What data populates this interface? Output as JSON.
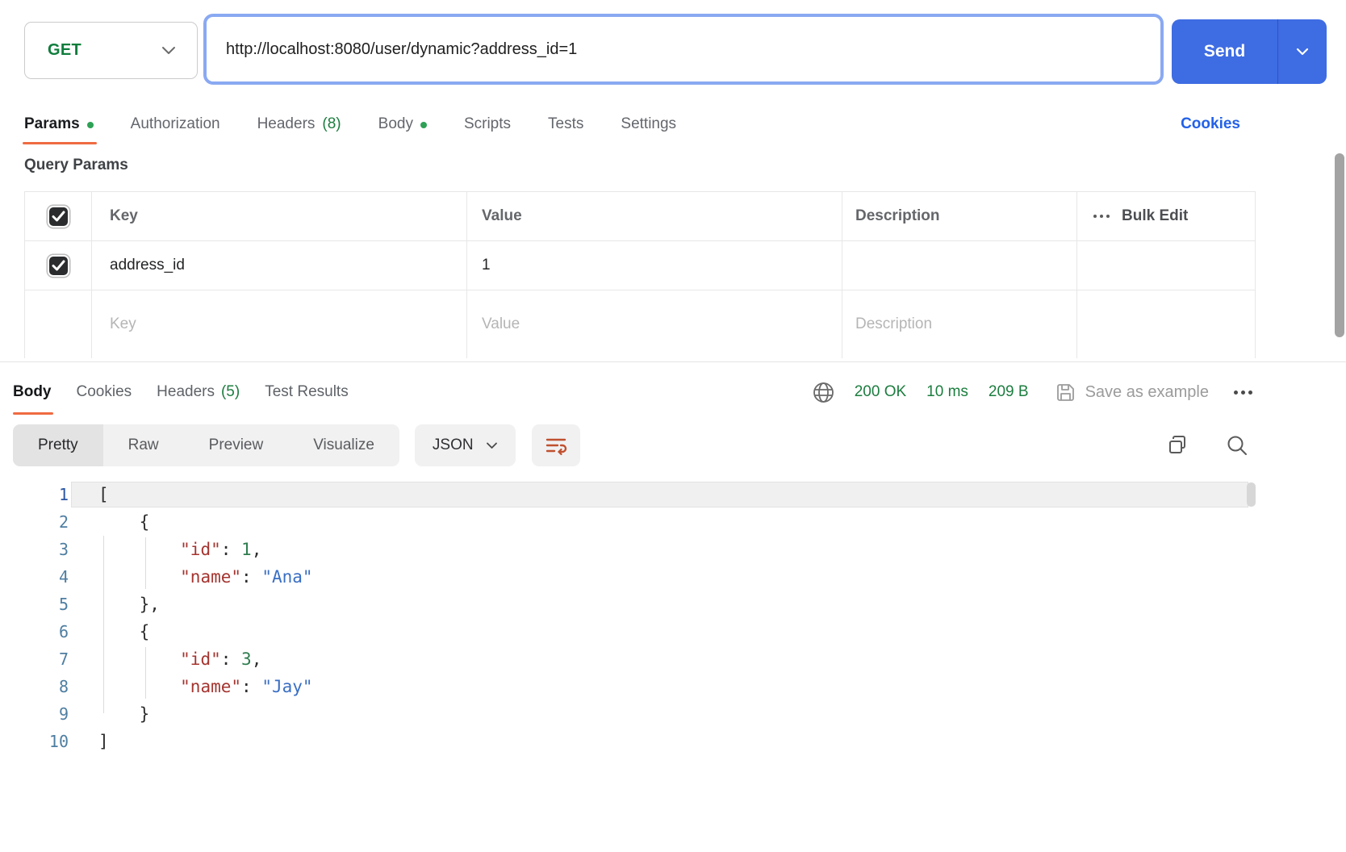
{
  "request_bar": {
    "method": "GET",
    "url": "http://localhost:8080/user/dynamic?address_id=1",
    "send_label": "Send"
  },
  "request_tabs": {
    "items": [
      {
        "label": "Params",
        "dot": true,
        "active": true
      },
      {
        "label": "Authorization"
      },
      {
        "label": "Headers",
        "count": "(8)"
      },
      {
        "label": "Body",
        "dot": true
      },
      {
        "label": "Scripts"
      },
      {
        "label": "Tests"
      },
      {
        "label": "Settings"
      }
    ],
    "cookies_link": "Cookies"
  },
  "query_params": {
    "title": "Query Params",
    "headers": {
      "key": "Key",
      "value": "Value",
      "description": "Description",
      "bulk_edit": "Bulk Edit"
    },
    "rows": [
      {
        "checked": true,
        "key": "address_id",
        "value": "1",
        "description": ""
      }
    ],
    "placeholder_row": {
      "key": "Key",
      "value": "Value",
      "description": "Description"
    }
  },
  "response": {
    "tabs": [
      {
        "label": "Body",
        "active": true
      },
      {
        "label": "Cookies"
      },
      {
        "label": "Headers",
        "count": "(5)"
      },
      {
        "label": "Test Results"
      }
    ],
    "status": {
      "code": "200 OK",
      "time": "10 ms",
      "size": "209 B"
    },
    "save_as_example": "Save as example",
    "view_modes": [
      "Pretty",
      "Raw",
      "Preview",
      "Visualize"
    ],
    "active_view": "Pretty",
    "format": "JSON",
    "code": {
      "active_line": 1,
      "lines": [
        {
          "n": "1",
          "tk": [
            [
              "p",
              "["
            ]
          ]
        },
        {
          "n": "2",
          "tk": [
            [
              "p",
              "    {"
            ]
          ]
        },
        {
          "n": "3",
          "tk": [
            [
              "p",
              "        "
            ],
            [
              "k",
              "\"id\""
            ],
            [
              "p",
              ": "
            ],
            [
              "num",
              "1"
            ],
            [
              "p",
              ","
            ]
          ]
        },
        {
          "n": "4",
          "tk": [
            [
              "p",
              "        "
            ],
            [
              "k",
              "\"name\""
            ],
            [
              "p",
              ": "
            ],
            [
              "s",
              "\"Ana\""
            ]
          ]
        },
        {
          "n": "5",
          "tk": [
            [
              "p",
              "    },"
            ]
          ]
        },
        {
          "n": "6",
          "tk": [
            [
              "p",
              "    {"
            ]
          ]
        },
        {
          "n": "7",
          "tk": [
            [
              "p",
              "        "
            ],
            [
              "k",
              "\"id\""
            ],
            [
              "p",
              ": "
            ],
            [
              "num",
              "3"
            ],
            [
              "p",
              ","
            ]
          ]
        },
        {
          "n": "8",
          "tk": [
            [
              "p",
              "        "
            ],
            [
              "k",
              "\"name\""
            ],
            [
              "p",
              ": "
            ],
            [
              "s",
              "\"Jay\""
            ]
          ]
        },
        {
          "n": "9",
          "tk": [
            [
              "p",
              "    }"
            ]
          ]
        },
        {
          "n": "10",
          "tk": [
            [
              "p",
              "]"
            ]
          ]
        }
      ]
    }
  },
  "colors": {
    "accent_orange": "#ef6b42",
    "send_blue": "#3e6ce2",
    "focus_ring_blue": "#8aa9f2",
    "link_blue": "#2361e8",
    "success_green": "#1c7d3f",
    "dot_green": "#2ea155",
    "method_green": "#0f7d3c",
    "code_key_red": "#a4342f",
    "code_string_blue": "#3a6fc3",
    "code_number_green": "#2f7d4f"
  }
}
